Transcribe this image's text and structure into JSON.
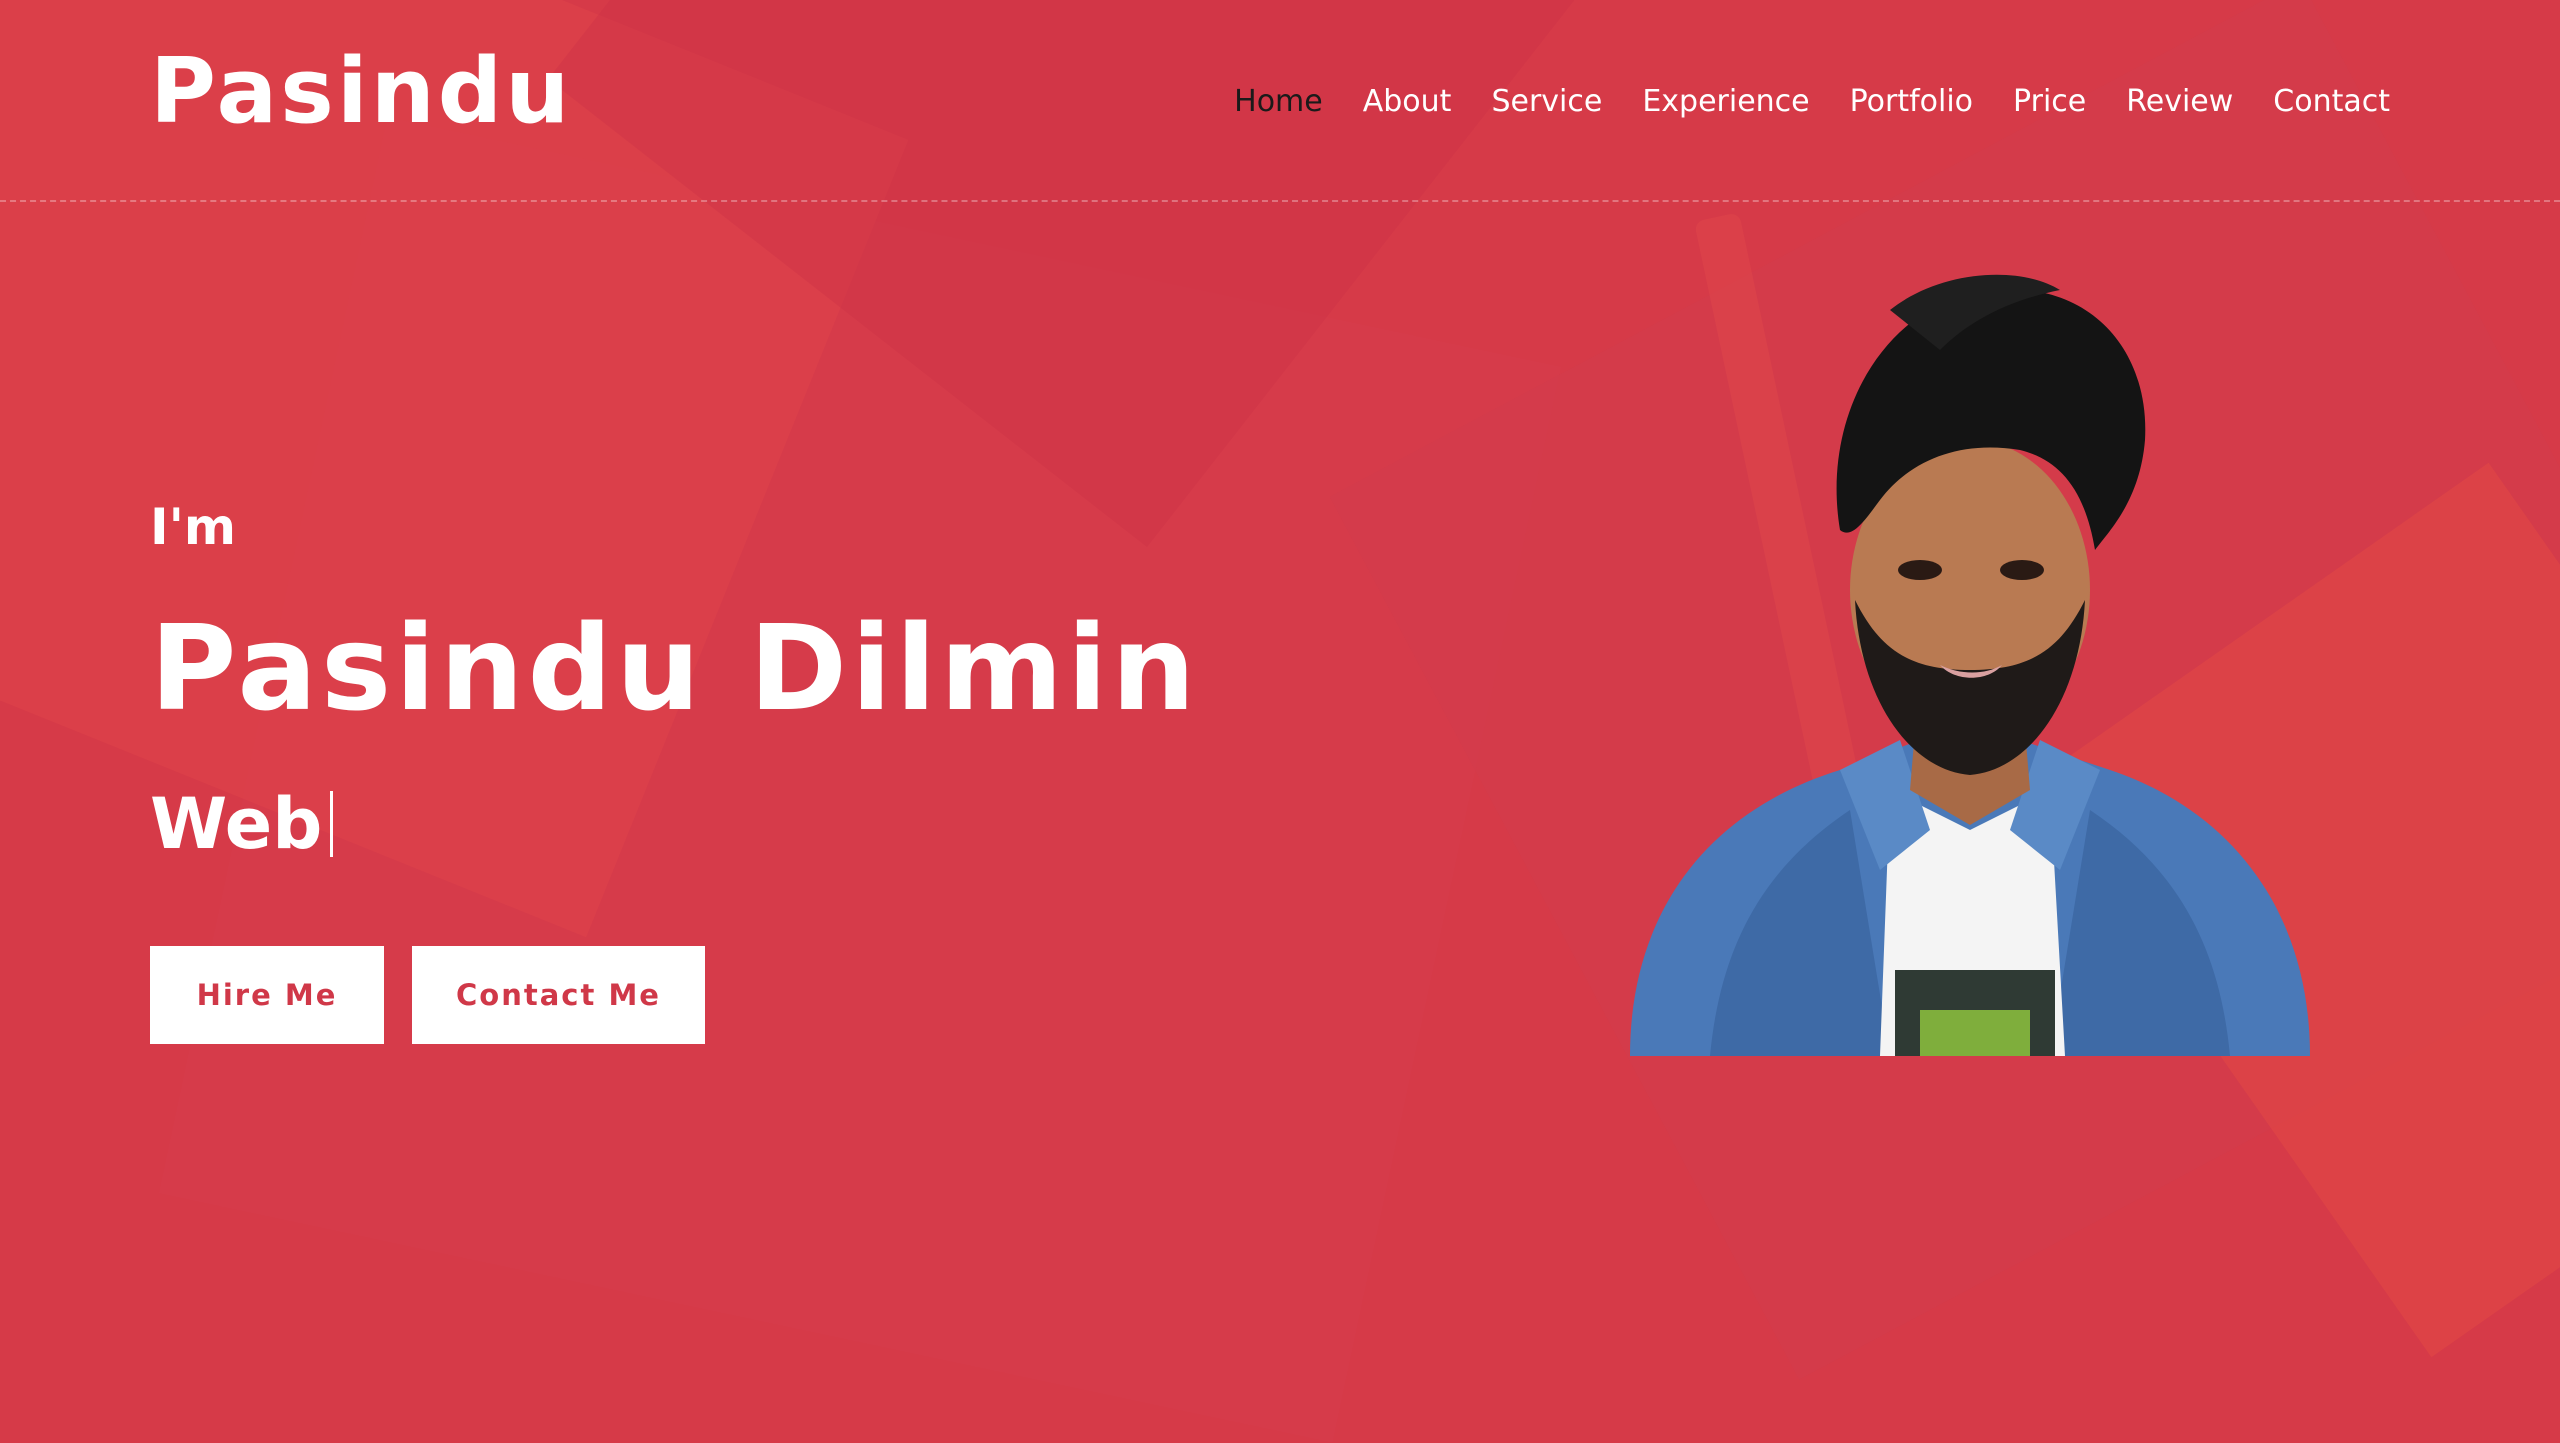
{
  "header": {
    "logo": "Pasindu",
    "nav": [
      {
        "label": "Home",
        "active": true
      },
      {
        "label": "About",
        "active": false
      },
      {
        "label": "Service",
        "active": false
      },
      {
        "label": "Experience",
        "active": false
      },
      {
        "label": "Portfolio",
        "active": false
      },
      {
        "label": "Price",
        "active": false
      },
      {
        "label": "Review",
        "active": false
      },
      {
        "label": "Contact",
        "active": false
      }
    ]
  },
  "hero": {
    "intro": "I'm",
    "name": "Pasindu Dilmin",
    "typed_role": "Web",
    "buttons": {
      "hire": "Hire Me",
      "contact": "Contact Me"
    }
  },
  "colors": {
    "background": "#d63a48",
    "accent": "#d03848",
    "text": "#ffffff",
    "active_nav": "#1a1a1a"
  }
}
